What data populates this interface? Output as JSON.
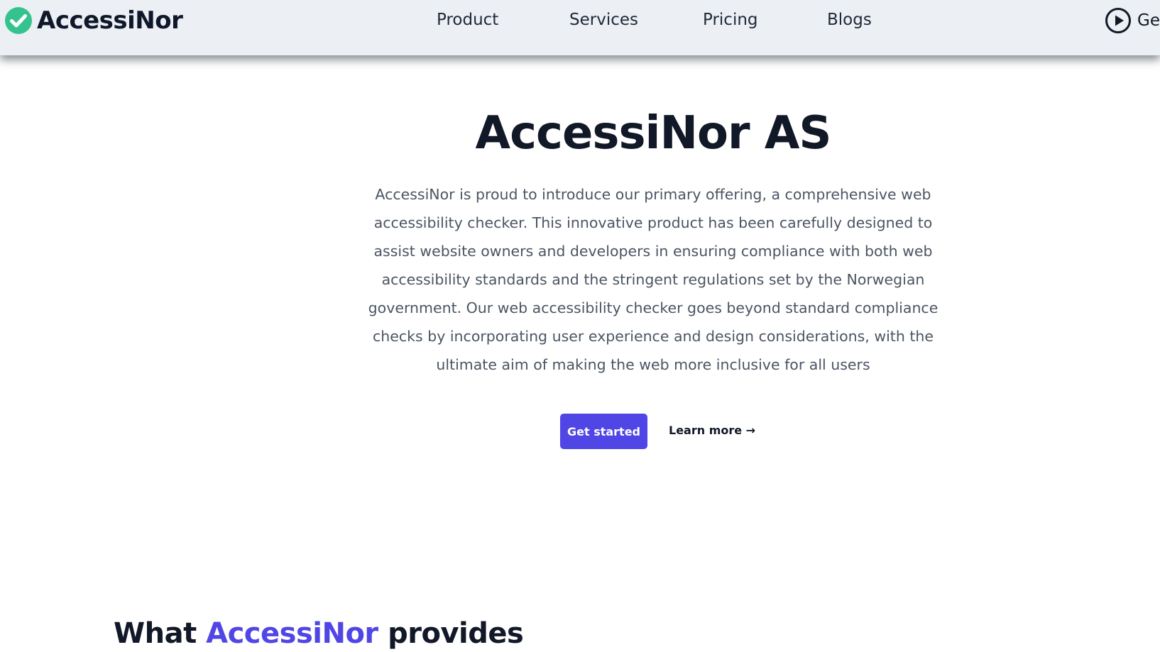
{
  "brand": {
    "name": "AccessiNor",
    "logo_icon": "check-circle-icon",
    "logo_color": "#34c38f"
  },
  "nav": {
    "links": [
      "Product",
      "Services",
      "Pricing",
      "Blogs"
    ],
    "cta_icon": "play-circle-icon",
    "cta_label": "Get"
  },
  "hero": {
    "title": "AccessiNor AS",
    "description": "AccessiNor is proud to introduce our primary offering, a comprehensive web accessibility checker. This innovative product has been carefully designed to assist website owners and developers in ensuring compliance with both web accessibility standards and the stringent regulations set by the Norwegian government. Our web accessibility checker goes beyond standard compliance checks by incorporating user experience and design considerations, with the ultimate aim of making the web more inclusive for all users",
    "primary_button": "Get started",
    "secondary_link": "Learn more →"
  },
  "section": {
    "title_prefix": "What ",
    "title_accent": "AccessiNor",
    "title_suffix": " provides"
  },
  "colors": {
    "accent": "#4f46e5",
    "navbar_bg": "#eceff3",
    "text_dark": "#111827",
    "text_muted": "#4b5563"
  }
}
